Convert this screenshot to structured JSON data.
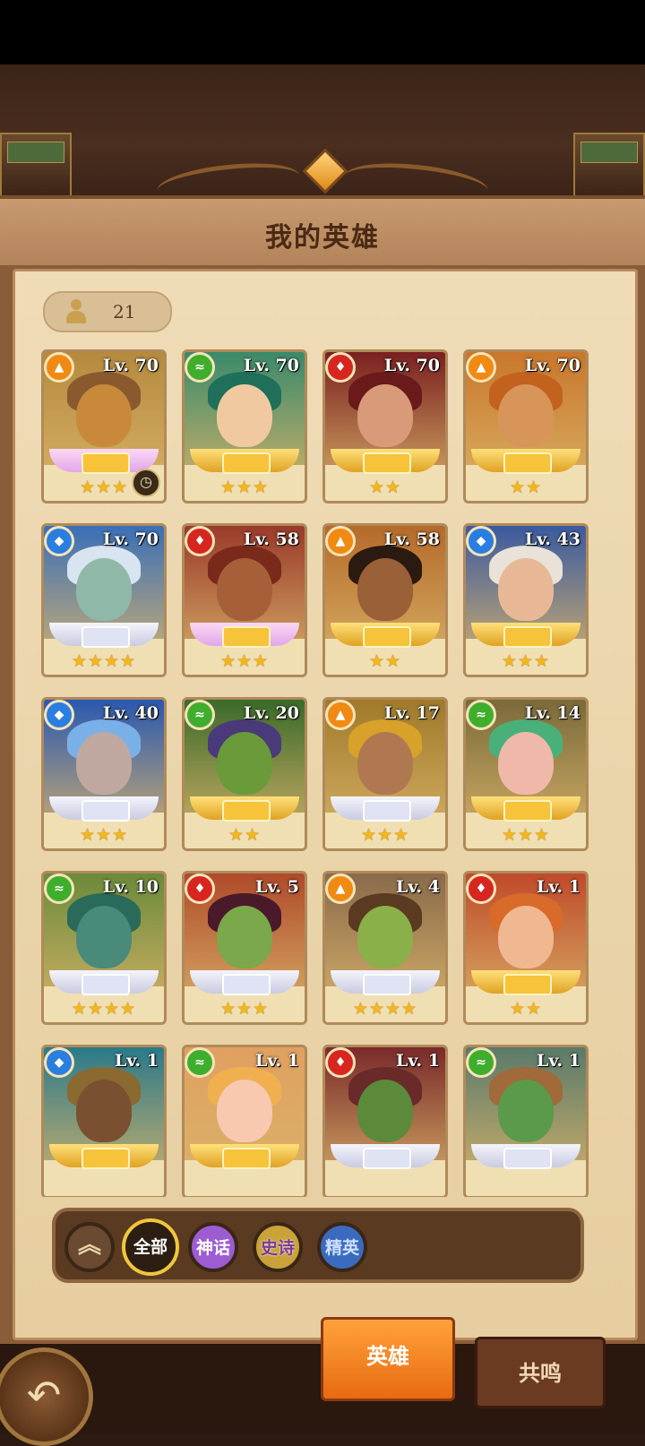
{
  "title": "我的英雄",
  "hero_count": "21",
  "heroes": [
    {
      "level": "Lv. 70",
      "element": "earth",
      "stars": "★★★",
      "frame": "pink",
      "hair": "#8a5a2e",
      "skin": "#c88a3a",
      "bg": "#b58a3e"
    },
    {
      "level": "Lv. 70",
      "element": "wind",
      "stars": "★★★",
      "frame": "gold",
      "hair": "#1f6f5a",
      "skin": "#f1c9a0",
      "bg": "#3a8a6a"
    },
    {
      "level": "Lv. 70",
      "element": "fire",
      "stars": "★★",
      "frame": "gold",
      "hair": "#6a1a1a",
      "skin": "#d89a78",
      "bg": "#7a2020"
    },
    {
      "level": "Lv. 70",
      "element": "earth",
      "stars": "★★",
      "frame": "gold",
      "hair": "#c2621e",
      "skin": "#d8955a",
      "bg": "#c9772a"
    },
    {
      "level": "Lv. 70",
      "element": "water",
      "stars": "★★★★",
      "frame": "silver",
      "hair": "#d8e4f0",
      "skin": "#8fb8a8",
      "bg": "#3a6fb8"
    },
    {
      "level": "Lv. 58",
      "element": "fire",
      "stars": "★★★",
      "frame": "pink",
      "hair": "#7a2a1a",
      "skin": "#a5603a",
      "bg": "#9a3a2a"
    },
    {
      "level": "Lv. 58",
      "element": "earth",
      "stars": "★★",
      "frame": "gold",
      "hair": "#2a1a10",
      "skin": "#9a6038",
      "bg": "#b56a2a"
    },
    {
      "level": "Lv. 43",
      "element": "water",
      "stars": "★★★",
      "frame": "gold",
      "hair": "#e8e2d8",
      "skin": "#e8b896",
      "bg": "#3a5aa0"
    },
    {
      "level": "Lv. 40",
      "element": "water",
      "stars": "★★★",
      "frame": "silver",
      "hair": "#7ab0e8",
      "skin": "#c0a8a0",
      "bg": "#2a58b0"
    },
    {
      "level": "Lv. 20",
      "element": "wind",
      "stars": "★★",
      "frame": "gold",
      "hair": "#4a3a7a",
      "skin": "#6a9a3a",
      "bg": "#3a6a2a"
    },
    {
      "level": "Lv. 17",
      "element": "earth",
      "stars": "★★★",
      "frame": "silver",
      "hair": "#d8a22a",
      "skin": "#b07850",
      "bg": "#a07a2a"
    },
    {
      "level": "Lv. 14",
      "element": "wind",
      "stars": "★★★",
      "frame": "gold",
      "hair": "#4ab07a",
      "skin": "#f0b8a8",
      "bg": "#7a6a3a"
    },
    {
      "level": "Lv. 10",
      "element": "wind",
      "stars": "★★★★",
      "frame": "silver",
      "hair": "#2a6a5a",
      "skin": "#4a8a7a",
      "bg": "#6a8a3a"
    },
    {
      "level": "Lv. 5",
      "element": "fire",
      "stars": "★★★",
      "frame": "silver",
      "hair": "#4a1a2a",
      "skin": "#7aa84a",
      "bg": "#b04a2a"
    },
    {
      "level": "Lv. 4",
      "element": "earth",
      "stars": "★★★★",
      "frame": "silver",
      "hair": "#5a3a20",
      "skin": "#8ab04a",
      "bg": "#8a6a4a"
    },
    {
      "level": "Lv. 1",
      "element": "fire",
      "stars": "★★",
      "frame": "gold",
      "hair": "#d86a2a",
      "skin": "#f0b890",
      "bg": "#c04a2a"
    },
    {
      "level": "Lv. 1",
      "element": "water",
      "stars": "",
      "frame": "gold",
      "hair": "#8a6a30",
      "skin": "#7a5030",
      "bg": "#2a7a8a"
    },
    {
      "level": "Lv. 1",
      "element": "wind",
      "stars": "",
      "frame": "gold",
      "hair": "#f0b050",
      "skin": "#f8c8b0",
      "bg": "#e0a060"
    },
    {
      "level": "Lv. 1",
      "element": "fire",
      "stars": "",
      "frame": "silver",
      "hair": "#6a2a2a",
      "skin": "#5a8a3a",
      "bg": "#7a2a2a"
    },
    {
      "level": "Lv. 1",
      "element": "wind",
      "stars": "",
      "frame": "silver",
      "hair": "#a06a3a",
      "skin": "#5a9a4a",
      "bg": "#5a7a6a"
    }
  ],
  "filters": {
    "up": "︽",
    "all": "全部",
    "myth": "神话",
    "epic": "史诗",
    "elite": "精英"
  },
  "tabs": {
    "heroes": "英雄",
    "resonance": "共鸣"
  },
  "back_icon": "↶"
}
